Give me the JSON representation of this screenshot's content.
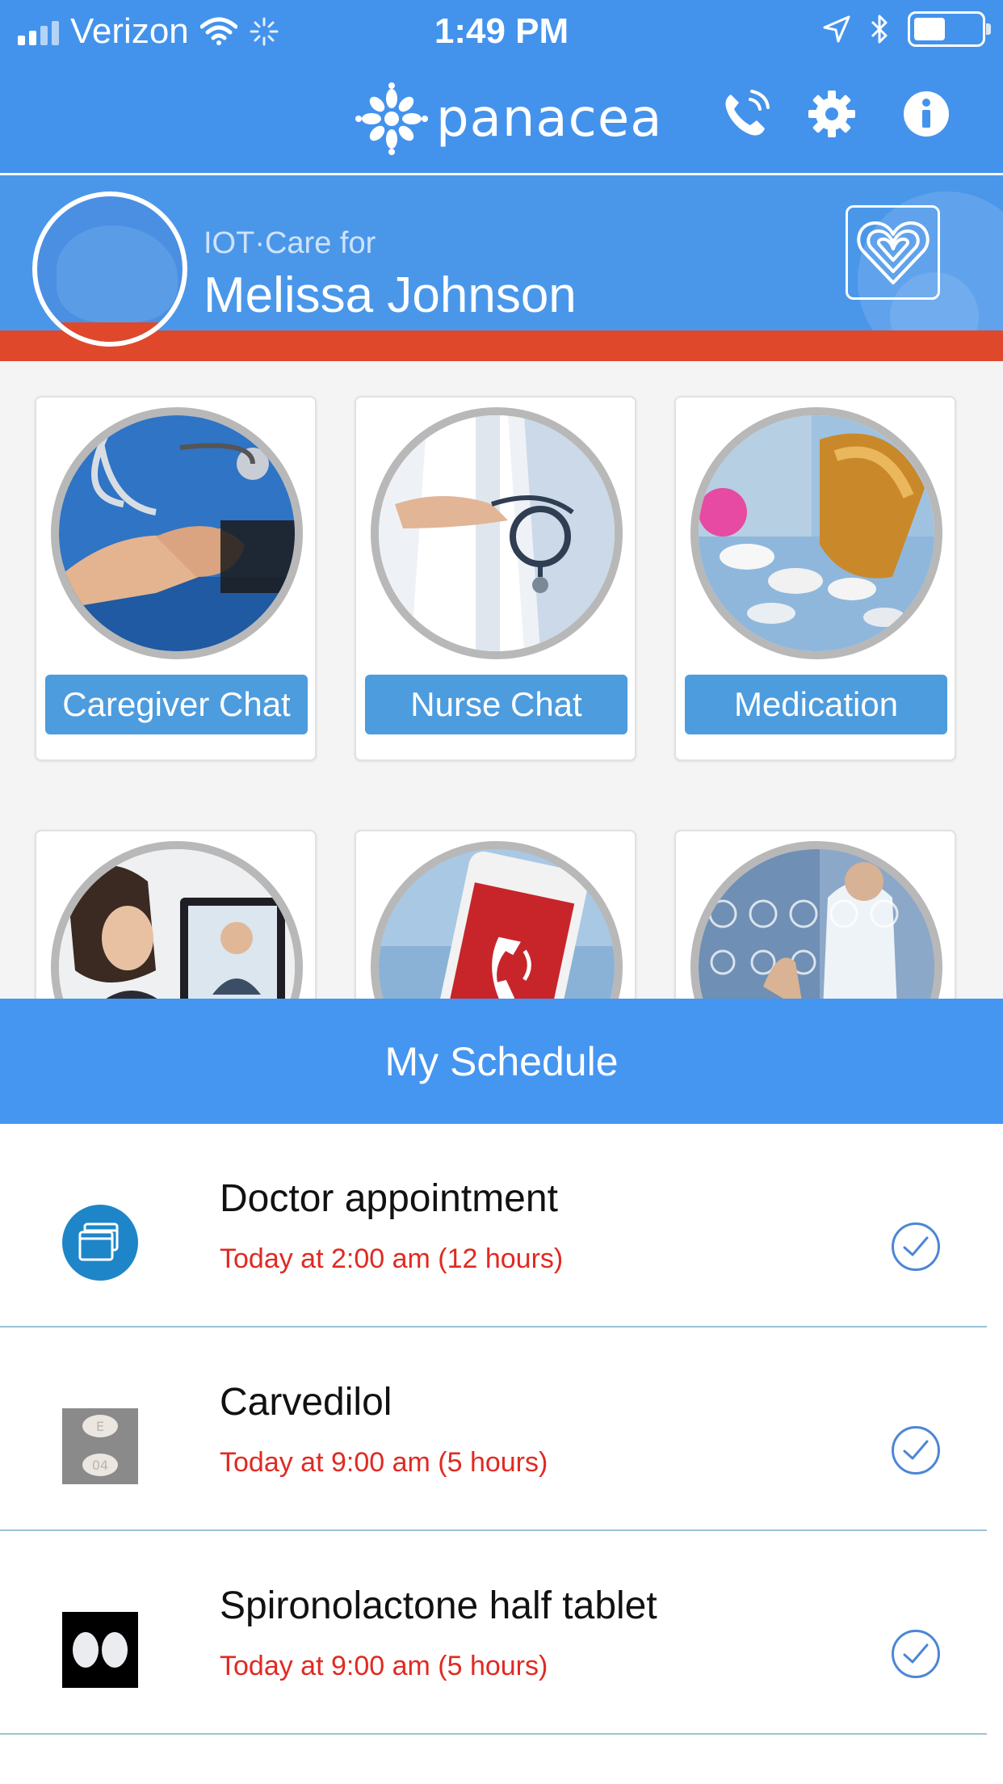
{
  "status_bar": {
    "carrier": "Verizon",
    "time": "1:49 PM",
    "battery_level": 0.45
  },
  "app_bar": {
    "brand": "panacea",
    "icons": [
      "phone-icon",
      "gear-icon",
      "info-icon"
    ]
  },
  "profile": {
    "care_label": "IOT·Care for",
    "name": "Melissa Johnson"
  },
  "tiles": [
    {
      "label": "Caregiver Chat"
    },
    {
      "label": "Nurse Chat"
    },
    {
      "label": "Medication"
    },
    {
      "label": ""
    },
    {
      "label": ""
    },
    {
      "label": ""
    }
  ],
  "schedule": {
    "title": "My Schedule",
    "items": [
      {
        "title": "Doctor appointment",
        "time": "Today at 2:00 am (12 hours)"
      },
      {
        "title": "Carvedilol",
        "time": "Today at 9:00 am (5 hours)"
      },
      {
        "title": "Spironolactone half tablet",
        "time": "Today at 9:00 am (5 hours)"
      }
    ]
  },
  "colors": {
    "header_blue": "#4393ec",
    "accent_red": "#e0482b",
    "tile_button": "#4d9cde",
    "schedule_time_red": "#e02a22"
  }
}
